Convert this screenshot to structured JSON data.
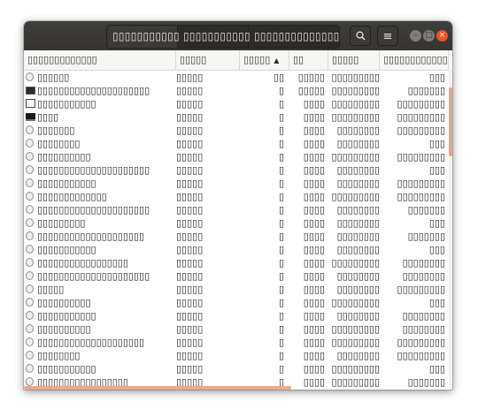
{
  "window": {
    "tabs": [
      {
        "label": "▯▯▯▯▯▯▯▯▯▯▯"
      },
      {
        "label": "▯▯▯▯▯▯▯▯▯▯▯"
      },
      {
        "label": "▯▯▯▯▯▯▯▯▯▯▯▯▯▯"
      }
    ],
    "search_icon": "search-icon",
    "menu_icon": "hamburger-menu-icon",
    "menu_glyph": "≡",
    "search_glyph": "⌕"
  },
  "columns": {
    "name": "▯▯▯▯▯▯▯▯▯▯▯▯▯",
    "user": "▯▯▯▯▯",
    "cpu": "▯▯▯▯▯",
    "id": "▯▯",
    "memory": "▯▯▯▯▯",
    "priority": "▯▯▯▯▯▯▯▯▯▯▯▯",
    "extra": "▯"
  },
  "sort": {
    "column": "cpu",
    "direction": "ascending"
  },
  "rows": [
    {
      "icon": "doc",
      "name": "▯▯▯▯▯▯",
      "user": "▯▯▯▯▯",
      "cpu": "▯▯",
      "id": "▯▯▯▯▯",
      "mem": "▯▯▯▯▯▯▯▯▯",
      "prio": "▯▯▯"
    },
    {
      "icon": "term",
      "name": "▯▯▯▯▯▯▯▯▯▯▯▯▯▯▯▯▯▯▯▯▯",
      "user": "▯▯▯▯▯",
      "cpu": "▯",
      "id": "▯▯▯▯▯",
      "mem": "▯▯▯▯▯▯▯▯▯",
      "prio": "▯▯▯▯▯▯▯"
    },
    {
      "icon": "win",
      "name": "▯▯▯▯▯▯▯▯▯▯▯",
      "user": "▯▯▯▯▯",
      "cpu": "▯",
      "id": "▯▯▯▯",
      "mem": "▯▯▯▯▯▯▯▯▯",
      "prio": "▯▯▯▯▯▯▯▯▯"
    },
    {
      "icon": "monitor",
      "name": "▯▯▯▯",
      "user": "▯▯▯▯▯",
      "cpu": "▯",
      "id": "▯▯▯▯",
      "mem": "▯▯▯▯▯▯▯▯▯",
      "prio": "▯▯▯▯▯▯▯▯▯"
    },
    {
      "icon": "doc",
      "name": "▯▯▯▯▯▯▯",
      "user": "▯▯▯▯▯",
      "cpu": "▯",
      "id": "▯▯▯▯",
      "mem": "▯▯▯▯▯▯▯▯",
      "prio": "▯▯▯▯▯▯▯▯▯"
    },
    {
      "icon": "doc",
      "name": "▯▯▯▯▯▯▯▯",
      "user": "▯▯▯▯▯",
      "cpu": "▯",
      "id": "▯▯▯▯",
      "mem": "▯▯▯▯▯▯▯▯",
      "prio": "▯▯▯"
    },
    {
      "icon": "doc",
      "name": "▯▯▯▯▯▯▯▯▯▯",
      "user": "▯▯▯▯▯",
      "cpu": "▯",
      "id": "▯▯▯▯",
      "mem": "▯▯▯▯▯▯▯▯▯",
      "prio": "▯▯▯▯▯▯▯▯▯"
    },
    {
      "icon": "doc",
      "name": "▯▯▯▯▯▯▯▯▯▯▯▯▯▯▯▯▯▯▯▯▯",
      "user": "▯▯▯▯▯",
      "cpu": "▯",
      "id": "▯▯▯▯",
      "mem": "▯▯▯▯▯▯▯▯",
      "prio": "▯▯▯"
    },
    {
      "icon": "doc",
      "name": "▯▯▯▯▯▯▯▯▯▯▯",
      "user": "▯▯▯▯▯",
      "cpu": "▯",
      "id": "▯▯▯▯",
      "mem": "▯▯▯▯▯▯▯▯",
      "prio": "▯▯▯▯▯▯▯▯▯"
    },
    {
      "icon": "doc",
      "name": "▯▯▯▯▯▯▯▯▯▯▯▯▯",
      "user": "▯▯▯▯▯",
      "cpu": "▯",
      "id": "▯▯▯▯",
      "mem": "▯▯▯▯▯▯▯▯▯",
      "prio": "▯▯▯▯▯▯▯▯▯"
    },
    {
      "icon": "doc",
      "name": "▯▯▯▯▯▯▯▯▯▯▯▯▯▯▯▯▯▯▯▯▯",
      "user": "▯▯▯▯▯",
      "cpu": "▯",
      "id": "▯▯▯▯",
      "mem": "▯▯▯▯▯▯▯▯",
      "prio": "▯▯▯▯▯▯▯"
    },
    {
      "icon": "doc",
      "name": "▯▯▯▯▯▯▯▯▯",
      "user": "▯▯▯▯▯",
      "cpu": "▯",
      "id": "▯▯▯▯",
      "mem": "▯▯▯▯▯▯▯▯",
      "prio": "▯▯▯"
    },
    {
      "icon": "doc",
      "name": "▯▯▯▯▯▯▯▯▯▯▯▯▯▯▯▯▯▯▯▯",
      "user": "▯▯▯▯▯",
      "cpu": "▯",
      "id": "▯▯▯▯",
      "mem": "▯▯▯▯▯▯▯▯",
      "prio": "▯▯▯▯▯▯▯"
    },
    {
      "icon": "doc",
      "name": "▯▯▯▯▯▯▯▯▯▯▯",
      "user": "▯▯▯▯▯",
      "cpu": "▯",
      "id": "▯▯▯▯",
      "mem": "▯▯▯▯▯▯▯▯",
      "prio": "▯▯▯"
    },
    {
      "icon": "doc",
      "name": "▯▯▯▯▯▯▯▯▯▯▯▯▯▯▯▯▯",
      "user": "▯▯▯▯▯",
      "cpu": "▯",
      "id": "▯▯▯▯",
      "mem": "▯▯▯▯▯▯▯▯▯",
      "prio": "▯▯▯▯▯▯▯▯"
    },
    {
      "icon": "doc",
      "name": "▯▯▯▯▯▯▯▯▯▯▯▯▯▯▯▯▯▯▯▯▯",
      "user": "▯▯▯▯▯",
      "cpu": "▯",
      "id": "▯▯▯▯",
      "mem": "▯▯▯▯▯▯▯▯",
      "prio": "▯▯▯▯▯▯▯▯"
    },
    {
      "icon": "doc",
      "name": "▯▯▯▯▯",
      "user": "▯▯▯▯▯",
      "cpu": "▯",
      "id": "▯▯▯▯",
      "mem": "▯▯▯▯▯▯▯▯",
      "prio": "▯▯▯▯▯▯▯▯▯"
    },
    {
      "icon": "doc",
      "name": "▯▯▯▯▯▯▯▯▯▯",
      "user": "▯▯▯▯▯",
      "cpu": "▯",
      "id": "▯▯▯▯",
      "mem": "▯▯▯▯▯▯▯▯▯",
      "prio": "▯▯▯"
    },
    {
      "icon": "doc",
      "name": "▯▯▯▯▯▯▯▯▯▯▯",
      "user": "▯▯▯▯▯",
      "cpu": "▯",
      "id": "▯▯▯▯",
      "mem": "▯▯▯▯▯▯▯▯",
      "prio": "▯▯▯▯▯▯▯▯"
    },
    {
      "icon": "doc",
      "name": "▯▯▯▯▯▯▯▯▯▯",
      "user": "▯▯▯▯▯",
      "cpu": "▯",
      "id": "▯▯▯▯",
      "mem": "▯▯▯▯▯▯▯▯▯",
      "prio": "▯▯▯▯▯▯▯▯"
    },
    {
      "icon": "doc",
      "name": "▯▯▯▯▯▯▯▯▯▯▯▯▯▯▯▯▯▯▯▯",
      "user": "▯▯▯▯▯",
      "cpu": "▯",
      "id": "▯▯▯▯",
      "mem": "▯▯▯▯▯▯▯▯▯",
      "prio": "▯▯▯▯▯▯▯▯▯"
    },
    {
      "icon": "doc",
      "name": "▯▯▯▯▯▯▯▯",
      "user": "▯▯▯▯▯",
      "cpu": "▯",
      "id": "▯▯▯▯",
      "mem": "▯▯▯▯▯▯▯▯",
      "prio": "▯▯▯▯▯▯▯▯▯"
    },
    {
      "icon": "doc",
      "name": "▯▯▯▯▯▯▯▯▯▯▯",
      "user": "▯▯▯▯▯",
      "cpu": "▯",
      "id": "▯▯▯▯",
      "mem": "▯▯▯▯▯▯▯▯▯",
      "prio": "▯▯▯"
    },
    {
      "icon": "doc",
      "name": "▯▯▯▯▯▯▯▯▯▯▯▯▯▯▯▯▯",
      "user": "▯▯▯▯▯",
      "cpu": "▯",
      "id": "▯▯▯▯",
      "mem": "▯▯▯▯▯▯▯▯▯",
      "prio": "▯▯▯▯▯▯▯"
    },
    {
      "icon": "doc",
      "name": "▯▯▯▯▯▯▯▯▯▯",
      "user": "▯▯▯▯▯",
      "cpu": "▯",
      "id": "▯▯▯▯",
      "mem": "▯▯▯▯▯▯▯▯",
      "prio": "▯▯▯▯▯▯▯"
    }
  ],
  "colors": {
    "accent": "#e95420",
    "titlebar": "#3a3935",
    "scrollbar": "#eda88f"
  }
}
